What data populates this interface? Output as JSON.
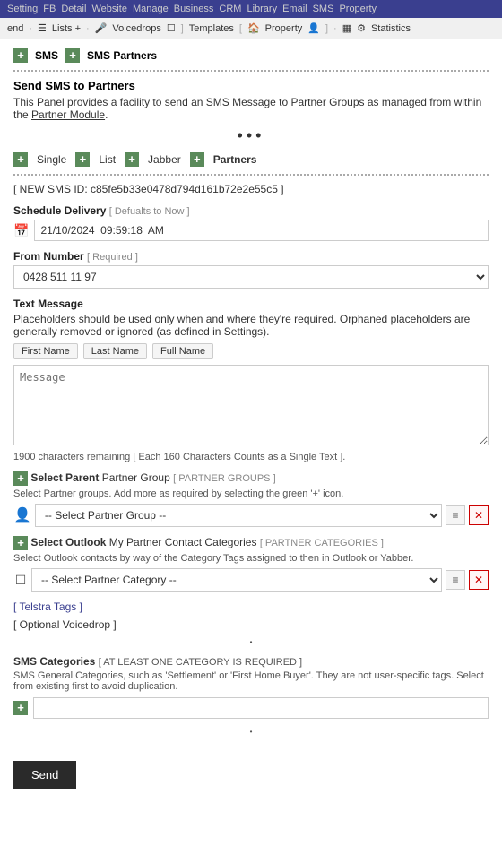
{
  "topNav": {
    "items": [
      "Setting",
      "FB",
      "Detail",
      "Website",
      "Manage",
      "Business",
      "CRM",
      "Library",
      "Email",
      "SMS",
      "Property"
    ]
  },
  "secondNav": {
    "items": [
      {
        "label": "end",
        "icon": ""
      },
      {
        "label": "Lists +",
        "icon": "list-icon"
      },
      {
        "label": "Voicedrops",
        "icon": "voicedrop-icon"
      },
      {
        "label": "Templates",
        "icon": "template-icon"
      },
      {
        "label": "Property",
        "icon": "property-icon"
      },
      {
        "label": "Statistics",
        "icon": "stats-icon"
      }
    ]
  },
  "sectionHeader": {
    "smsLabel": "SMS",
    "smsPartnersLabel": "SMS Partners"
  },
  "panelTitle": "Send SMS to Partners",
  "panelDescription": "This Panel provides a facility to send an SMS Message to Partner Groups as managed from within the ",
  "panelDescriptionLink": "Partner Module",
  "tabs": [
    {
      "label": "Single"
    },
    {
      "label": "List"
    },
    {
      "label": "Jabber"
    },
    {
      "label": "Partners"
    }
  ],
  "newSmsId": "NEW SMS ID: c85fe5b33e0478d794d161b72e2e55c5",
  "scheduleDelivery": {
    "label": "Schedule Delivery",
    "note": "[ Defualts to Now ]",
    "value": "21/10/2024  09:59:18  AM"
  },
  "fromNumber": {
    "label": "From Number",
    "note": "[ Required ]",
    "value": "0428 511 11 97"
  },
  "textMessage": {
    "label": "Text Message",
    "description": "Placeholders should be used only when and where they're required. Orphaned placeholders are generally removed or ignored (as defined in Settings).",
    "placeholders": [
      "First Name",
      "Last Name",
      "Full Name"
    ],
    "messagePlaceholder": "Message",
    "charCount": "1900 characters remaining",
    "charNote": "[ Each 160 Characters Counts as a Single Text ]."
  },
  "selectPartner": {
    "title": "Select Parent",
    "titleExtra": "Partner Group",
    "note": "[ PARTNER GROUPS ]",
    "description": "Select Partner groups. Add more as required by selecting the green '+' icon.",
    "placeholder": "-- Select Partner Group --"
  },
  "selectOutlook": {
    "title": "Select Outlook",
    "titleExtra": "My Partner Contact Categories",
    "note": "[ PARTNER CATEGORIES ]",
    "description": "Select Outlook contacts by way of the Category Tags assigned to then in Outlook or Yabber.",
    "placeholder": "-- Select Partner Category --"
  },
  "telstraTags": "[ Telstra Tags ]",
  "optionalVoicedrop": "[ Optional Voicedrop ]",
  "smsCategories": {
    "title": "SMS Categories",
    "note": "[ AT LEAST ONE CATEGORY IS REQUIRED ]",
    "description": "SMS General Categories, such as 'Settlement' or 'First Home Buyer'. They are not user-specific tags. Select from existing first to avoid duplication."
  },
  "sendButton": "Send",
  "icons": {
    "plus": "+",
    "calendar": "📅",
    "person": "👤",
    "checkbox": "☐",
    "hamburger": "≡",
    "close": "✕",
    "gear": "⚙",
    "dots": "•••"
  }
}
